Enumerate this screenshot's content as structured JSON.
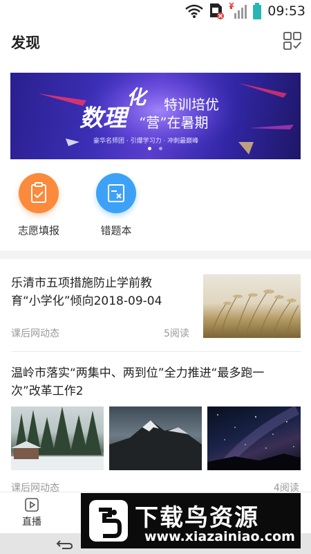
{
  "status_bar": {
    "time": "09:53"
  },
  "header": {
    "title": "发现",
    "scan_icon": "scan-icon"
  },
  "banner": {
    "headline_a": "数理",
    "headline_b": "化",
    "headline_c": "特训培优",
    "headline_d": "“营”在暑期",
    "tagline": "豪华名师团 · 引爆学习力 · 冲刺最巅峰",
    "dot_count": 2,
    "active_dot": 0
  },
  "quick_entries": [
    {
      "label": "志愿填报",
      "icon": "clipboard-check-icon",
      "color": "#fb8a3c"
    },
    {
      "label": "错题本",
      "icon": "wrong-question-book-icon",
      "color": "#3da2f7"
    }
  ],
  "articles": [
    {
      "title_line1": "乐清市五项措施防止学前教",
      "title_line2": "育“小学化”倾向2018-09-04",
      "source": "课后网动态",
      "reads": "5阅读"
    },
    {
      "title_line1": "温岭市落实“两集中、两到位”全力推进“最多跑一",
      "title_line2": "次”改革工作2",
      "source": "课后网动态",
      "reads": "4阅读"
    }
  ],
  "tab_bar": {
    "live_label": "直播"
  },
  "watermark": {
    "title": "下载鸟资源",
    "url": "www.xiazainiao.com"
  },
  "colors": {
    "orange": "#fb8a3c",
    "blue": "#3da2f7",
    "banner_purple": "#3b2fb6"
  }
}
